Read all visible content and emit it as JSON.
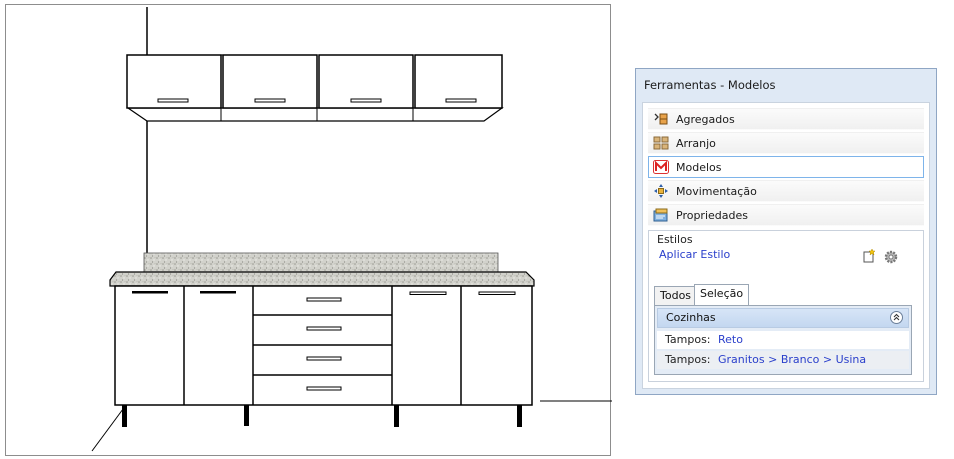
{
  "panel": {
    "title": "Ferramentas - Modelos",
    "nav_items": [
      {
        "label": "Agregados",
        "icon": "aggregates-icon"
      },
      {
        "label": "Arranjo",
        "icon": "arrangement-grid-icon"
      },
      {
        "label": "Modelos",
        "icon": "models-m-icon",
        "selected": true
      },
      {
        "label": "Movimentação",
        "icon": "move-arrows-icon"
      },
      {
        "label": "Propriedades",
        "icon": "properties-icon"
      }
    ],
    "estilos": {
      "title": "Estilos",
      "apply_link": "Aplicar Estilo"
    },
    "tabs": [
      {
        "label": "Todos",
        "active": false
      },
      {
        "label": "Seleção",
        "active": true
      }
    ],
    "group": {
      "title": "Cozinhas",
      "rows": [
        {
          "key": "Tampos:",
          "value": "Reto"
        },
        {
          "key": "Tampos:",
          "value": "Granitos > Branco > Usina"
        }
      ]
    }
  },
  "colors": {
    "panel_bg": "#dfe9f5",
    "link": "#2a3fcb",
    "selected_border": "#7eb4ea"
  }
}
